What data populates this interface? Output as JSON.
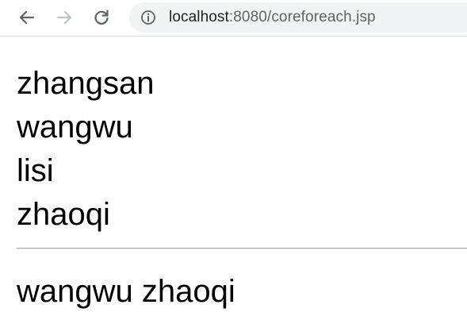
{
  "browser": {
    "url_host": "localhost",
    "url_rest": ":8080/coreforeach.jsp",
    "icons": {
      "back": "arrow-left-icon",
      "forward": "arrow-right-icon",
      "reload": "reload-icon",
      "info": "info-circle-icon"
    },
    "colors": {
      "icon_active": "#5f6368",
      "icon_disabled": "#bdc1c6",
      "omnibox_bg": "#f1f3f4"
    }
  },
  "page": {
    "names": [
      "zhangsan",
      "wangwu",
      "lisi",
      "zhaoqi"
    ],
    "filtered_line": "wangwu zhaoqi"
  }
}
